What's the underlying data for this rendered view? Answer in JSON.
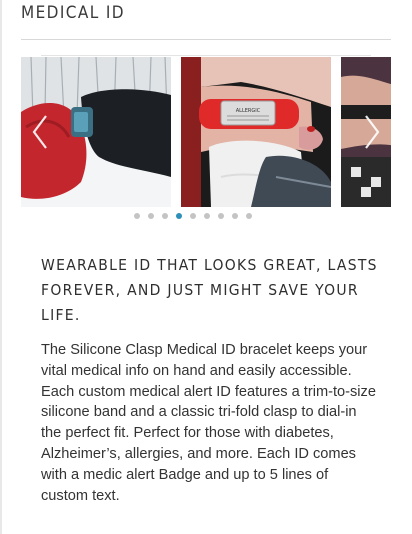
{
  "section": {
    "title": "MEDICAL ID"
  },
  "carousel": {
    "slides": [
      {
        "name": "winter-wrist-photo"
      },
      {
        "name": "red-bracelet-on-wrist-photo",
        "plate_text": "ALLERGIC"
      },
      {
        "name": "partial-wrist-photo"
      }
    ],
    "prev_icon": "chevron-left-icon",
    "next_icon": "chevron-right-icon",
    "dot_count": 9,
    "active_dot": 3,
    "accent_color": "#2e8fb8"
  },
  "product": {
    "headline": "WEARABLE ID THAT LOOKS GREAT, LASTS FOREVER, AND JUST MIGHT SAVE YOUR LIFE.",
    "description": "The Silicone Clasp Medical ID bracelet keeps your vital medical info on hand and easily accessible. Each custom medical alert ID features a trim-to-size silicone band and a classic tri-fold clasp to dial-in the perfect fit. Perfect for those with diabetes, Alzheimer’s, allergies, and more. Each ID comes with a medic alert Badge and up to 5 lines of custom text."
  }
}
